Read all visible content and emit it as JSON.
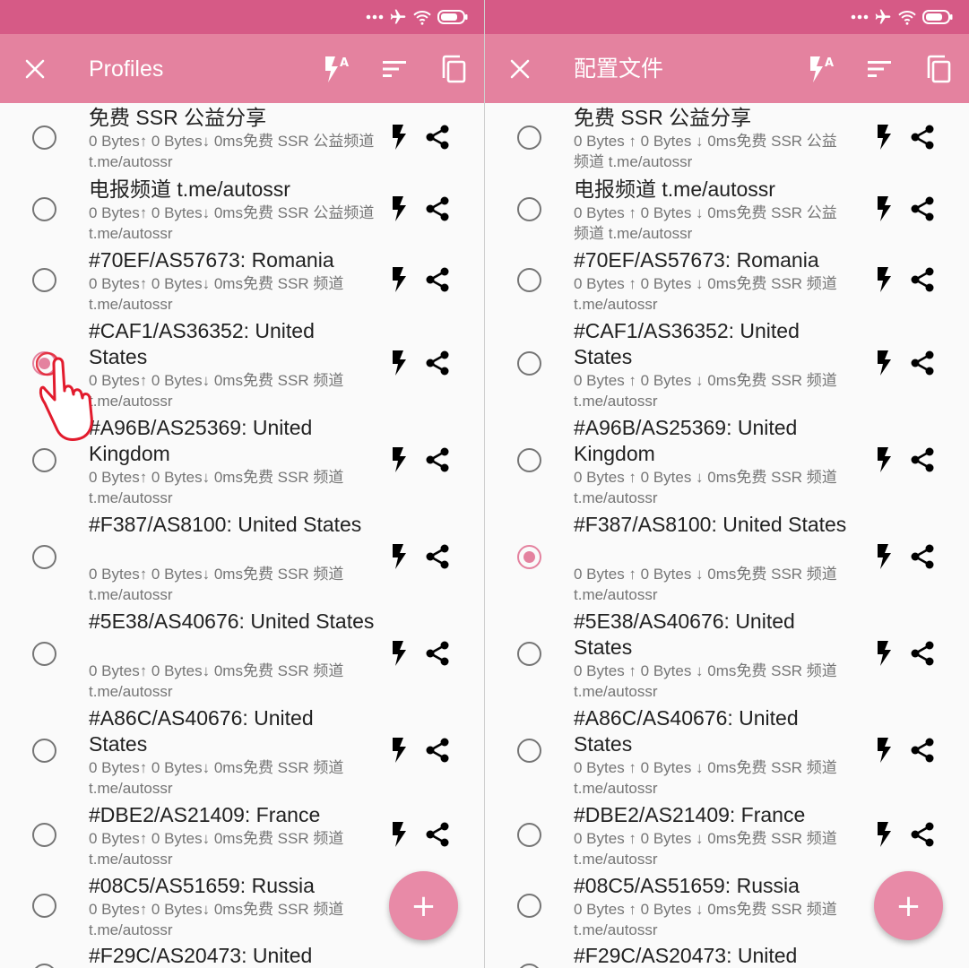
{
  "theme": {
    "status_bar": "#d65a86",
    "toolbar": "#e4829f",
    "accent": "#e4829f",
    "fab": "#e88aa7"
  },
  "status_icons": [
    "more-dots-icon",
    "airplane-icon",
    "wifi-icon",
    "battery-icon"
  ],
  "left": {
    "toolbar": {
      "title": "Profiles",
      "icons": [
        "close-icon",
        "flash-auto-icon",
        "sort-icon",
        "copy-icon"
      ]
    },
    "selected_index": 3,
    "profiles": [
      {
        "title": "免费 SSR 公益分享",
        "subtitle": "0 Bytes↑ 0 Bytes↓ 0ms免费 SSR 公益频道 t.me/autossr"
      },
      {
        "title": "电报频道 t.me/autossr",
        "subtitle": "0 Bytes↑ 0 Bytes↓ 0ms免费 SSR 公益频道 t.me/autossr"
      },
      {
        "title": "#70EF/AS57673: Romania",
        "subtitle": "0 Bytes↑ 0 Bytes↓ 0ms免费 SSR 频道 t.me/autossr"
      },
      {
        "title": "#CAF1/AS36352: United States",
        "subtitle": "0 Bytes↑ 0 Bytes↓ 0ms免费 SSR 频道 t.me/autossr"
      },
      {
        "title": "#A96B/AS25369: United Kingdom",
        "subtitle": "0 Bytes↑ 0 Bytes↓ 0ms免费 SSR 频道 t.me/autossr"
      },
      {
        "title": "#F387/AS8100: United States",
        "subtitle": "0 Bytes↑ 0 Bytes↓ 0ms免费 SSR 频道 t.me/autossr"
      },
      {
        "title": "#5E38/AS40676: United States",
        "subtitle": "0 Bytes↑ 0 Bytes↓ 0ms免费 SSR 频道 t.me/autossr"
      },
      {
        "title": "#A86C/AS40676: United States",
        "subtitle": "0 Bytes↑ 0 Bytes↓ 0ms免费 SSR 频道 t.me/autossr"
      },
      {
        "title": "#DBE2/AS21409: France",
        "subtitle": "0 Bytes↑ 0 Bytes↓ 0ms免费 SSR 频道 t.me/autossr"
      },
      {
        "title": "#08C5/AS51659: Russia",
        "subtitle": "0 Bytes↑ 0 Bytes↓ 0ms免费 SSR 频道 t.me/autossr"
      },
      {
        "title": "#F29C/AS20473: United",
        "subtitle": ""
      }
    ],
    "fab_label": "+"
  },
  "right": {
    "toolbar": {
      "title": "配置文件",
      "icons": [
        "close-icon",
        "flash-auto-icon",
        "sort-icon",
        "copy-icon"
      ]
    },
    "selected_index": 5,
    "profiles": [
      {
        "title": "免费 SSR 公益分享",
        "subtitle": "0 Bytes ↑  0 Bytes ↓  0ms免费 SSR 公益频道 t.me/autossr"
      },
      {
        "title": "电报频道 t.me/autossr",
        "subtitle": "0 Bytes ↑  0 Bytes ↓  0ms免费 SSR 公益频道 t.me/autossr"
      },
      {
        "title": "#70EF/AS57673: Romania",
        "subtitle": "0 Bytes ↑  0 Bytes ↓  0ms免费 SSR 频道 t.me/autossr"
      },
      {
        "title": "#CAF1/AS36352: United States",
        "subtitle": "0 Bytes ↑  0 Bytes ↓  0ms免费 SSR 频道 t.me/autossr"
      },
      {
        "title": "#A96B/AS25369: United Kingdom",
        "subtitle": "0 Bytes ↑  0 Bytes ↓  0ms免费 SSR 频道 t.me/autossr"
      },
      {
        "title": "#F387/AS8100: United States",
        "subtitle": "0 Bytes ↑  0 Bytes ↓  0ms免费 SSR 频道 t.me/autossr"
      },
      {
        "title": "#5E38/AS40676: United States",
        "subtitle": "0 Bytes ↑  0 Bytes ↓  0ms免费 SSR 频道 t.me/autossr"
      },
      {
        "title": "#A86C/AS40676: United States",
        "subtitle": "0 Bytes ↑  0 Bytes ↓  0ms免费 SSR 频道 t.me/autossr"
      },
      {
        "title": "#DBE2/AS21409: France",
        "subtitle": "0 Bytes ↑  0 Bytes ↓  0ms免费 SSR 频道 t.me/autossr"
      },
      {
        "title": "#08C5/AS51659: Russia",
        "subtitle": "0 Bytes ↑  0 Bytes ↓  0ms免费 SSR 频道 t.me/autossr"
      },
      {
        "title": "#F29C/AS20473: United",
        "subtitle": ""
      }
    ],
    "fab_label": "+"
  }
}
